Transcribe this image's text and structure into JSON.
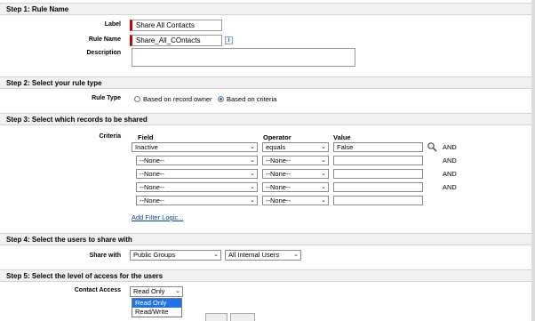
{
  "step1": {
    "header": "Step 1: Rule Name",
    "label_label": "Label",
    "label_value": "Share All Contacts",
    "rule_name_label": "Rule Name",
    "rule_name_value": "Share_All_COntacts",
    "description_label": "Description",
    "description_value": ""
  },
  "step2": {
    "header": "Step 2: Select your rule type",
    "rule_type_label": "Rule Type",
    "option_owner": "Based on record owner",
    "option_criteria": "Based on criteria",
    "selected": "Based on criteria"
  },
  "step3": {
    "header": "Step 3: Select which records to be shared",
    "criteria_label": "Criteria",
    "col_field": "Field",
    "col_operator": "Operator",
    "col_value": "Value",
    "rows": [
      {
        "field": "Inactive",
        "operator": "equals",
        "value": "False",
        "conj": "AND"
      },
      {
        "field": "--None--",
        "operator": "--None--",
        "value": "",
        "conj": "AND"
      },
      {
        "field": "--None--",
        "operator": "--None--",
        "value": "",
        "conj": "AND"
      },
      {
        "field": "--None--",
        "operator": "--None--",
        "value": "",
        "conj": "AND"
      },
      {
        "field": "--None--",
        "operator": "--None--",
        "value": "",
        "conj": ""
      }
    ],
    "add_filter_logic": "Add Filter Logic..."
  },
  "step4": {
    "header": "Step 4: Select the users to share with",
    "share_with_label": "Share with",
    "group_type": "Public Groups",
    "group_name": "All Internal Users"
  },
  "step5": {
    "header": "Step 5: Select the level of access for the users",
    "contact_access_label": "Contact Access",
    "selected": "Read Only",
    "options": [
      "Read Only",
      "Read/Write"
    ]
  },
  "icons": {
    "info": "info-icon",
    "lookup": "magnifier-lookup-icon",
    "dropdown": "chevron-down-icon"
  },
  "colors": {
    "required": "#cc0000",
    "header_bg": "#f1f1f1",
    "highlight": "#1e73e8",
    "link": "#0645ad"
  }
}
